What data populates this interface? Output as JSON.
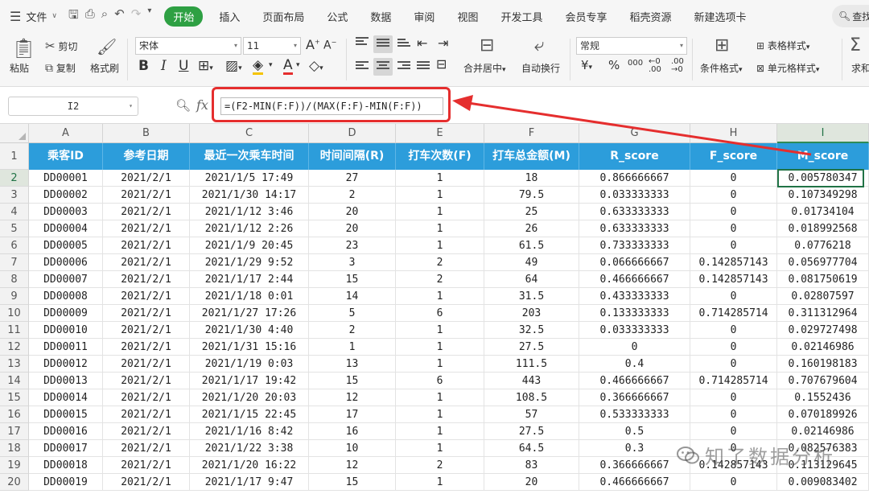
{
  "menu": {
    "file_label": "文件",
    "tabs": [
      "开始",
      "插入",
      "页面布局",
      "公式",
      "数据",
      "审阅",
      "视图",
      "开发工具",
      "会员专享",
      "稻壳资源",
      "新建选项卡"
    ],
    "search_label": "查找"
  },
  "ribbon": {
    "paste": "粘贴",
    "cut": "剪切",
    "copy": "复制",
    "format_painter": "格式刷",
    "font_name": "宋体",
    "font_size": "11",
    "merge_center": "合并居中",
    "wrap_text": "自动换行",
    "number_format": "常规",
    "conditional_format": "条件格式",
    "table_style": "表格样式",
    "cell_style": "单元格样式",
    "sum": "求和"
  },
  "formula_bar": {
    "name_box": "I2",
    "fx": "fx",
    "formula": "=(F2-MIN(F:F))/(MAX(F:F)-MIN(F:F))"
  },
  "sheet": {
    "columns": [
      "A",
      "B",
      "C",
      "D",
      "E",
      "F",
      "G",
      "H",
      "I"
    ],
    "selected_column": "I",
    "headers": [
      "乘客ID",
      "参考日期",
      "最近一次乘车时间",
      "时间间隔(R)",
      "打车次数(F)",
      "打车总金额(M)",
      "R_score",
      "F_score",
      "M_score"
    ],
    "row_numbers": [
      "1",
      "2",
      "3",
      "4",
      "5",
      "6",
      "7",
      "8",
      "9",
      "10",
      "11",
      "12",
      "13",
      "14",
      "15",
      "16",
      "17",
      "18",
      "19",
      "20"
    ],
    "selected_row": "2",
    "rows": [
      [
        "DD00001",
        "2021/2/1",
        "2021/1/5 17:49",
        "27",
        "1",
        "18",
        "0.866666667",
        "0",
        "0.005780347"
      ],
      [
        "DD00002",
        "2021/2/1",
        "2021/1/30 14:17",
        "2",
        "1",
        "79.5",
        "0.033333333",
        "0",
        "0.107349298"
      ],
      [
        "DD00003",
        "2021/2/1",
        "2021/1/12 3:46",
        "20",
        "1",
        "25",
        "0.633333333",
        "0",
        "0.01734104"
      ],
      [
        "DD00004",
        "2021/2/1",
        "2021/1/12 2:26",
        "20",
        "1",
        "26",
        "0.633333333",
        "0",
        "0.018992568"
      ],
      [
        "DD00005",
        "2021/2/1",
        "2021/1/9 20:45",
        "23",
        "1",
        "61.5",
        "0.733333333",
        "0",
        "0.0776218"
      ],
      [
        "DD00006",
        "2021/2/1",
        "2021/1/29 9:52",
        "3",
        "2",
        "49",
        "0.066666667",
        "0.142857143",
        "0.056977704"
      ],
      [
        "DD00007",
        "2021/2/1",
        "2021/1/17 2:44",
        "15",
        "2",
        "64",
        "0.466666667",
        "0.142857143",
        "0.081750619"
      ],
      [
        "DD00008",
        "2021/2/1",
        "2021/1/18 0:01",
        "14",
        "1",
        "31.5",
        "0.433333333",
        "0",
        "0.02807597"
      ],
      [
        "DD00009",
        "2021/2/1",
        "2021/1/27 17:26",
        "5",
        "6",
        "203",
        "0.133333333",
        "0.714285714",
        "0.311312964"
      ],
      [
        "DD00010",
        "2021/2/1",
        "2021/1/30 4:40",
        "2",
        "1",
        "32.5",
        "0.033333333",
        "0",
        "0.029727498"
      ],
      [
        "DD00011",
        "2021/2/1",
        "2021/1/31 15:16",
        "1",
        "1",
        "27.5",
        "0",
        "0",
        "0.02146986"
      ],
      [
        "DD00012",
        "2021/2/1",
        "2021/1/19 0:03",
        "13",
        "1",
        "111.5",
        "0.4",
        "0",
        "0.160198183"
      ],
      [
        "DD00013",
        "2021/2/1",
        "2021/1/17 19:42",
        "15",
        "6",
        "443",
        "0.466666667",
        "0.714285714",
        "0.707679604"
      ],
      [
        "DD00014",
        "2021/2/1",
        "2021/1/20 20:03",
        "12",
        "1",
        "108.5",
        "0.366666667",
        "0",
        "0.1552436"
      ],
      [
        "DD00015",
        "2021/2/1",
        "2021/1/15 22:45",
        "17",
        "1",
        "57",
        "0.533333333",
        "0",
        "0.070189926"
      ],
      [
        "DD00016",
        "2021/2/1",
        "2021/1/16 8:42",
        "16",
        "1",
        "27.5",
        "0.5",
        "0",
        "0.02146986"
      ],
      [
        "DD00017",
        "2021/2/1",
        "2021/1/22 3:38",
        "10",
        "1",
        "64.5",
        "0.3",
        "0",
        "0.082576383"
      ],
      [
        "DD00018",
        "2021/2/1",
        "2021/1/20 16:22",
        "12",
        "2",
        "83",
        "0.366666667",
        "0.142857143",
        "0.113129645"
      ],
      [
        "DD00019",
        "2021/2/1",
        "2021/1/17 9:47",
        "15",
        "1",
        "20",
        "0.466666667",
        "0",
        "0.009083402"
      ]
    ]
  },
  "watermark": {
    "text": "知了数据分析"
  },
  "colors": {
    "header_fill": "#2c9ddb",
    "active_tab": "#2ea043",
    "annotation": "#e52e2e",
    "selection": "#217346"
  }
}
